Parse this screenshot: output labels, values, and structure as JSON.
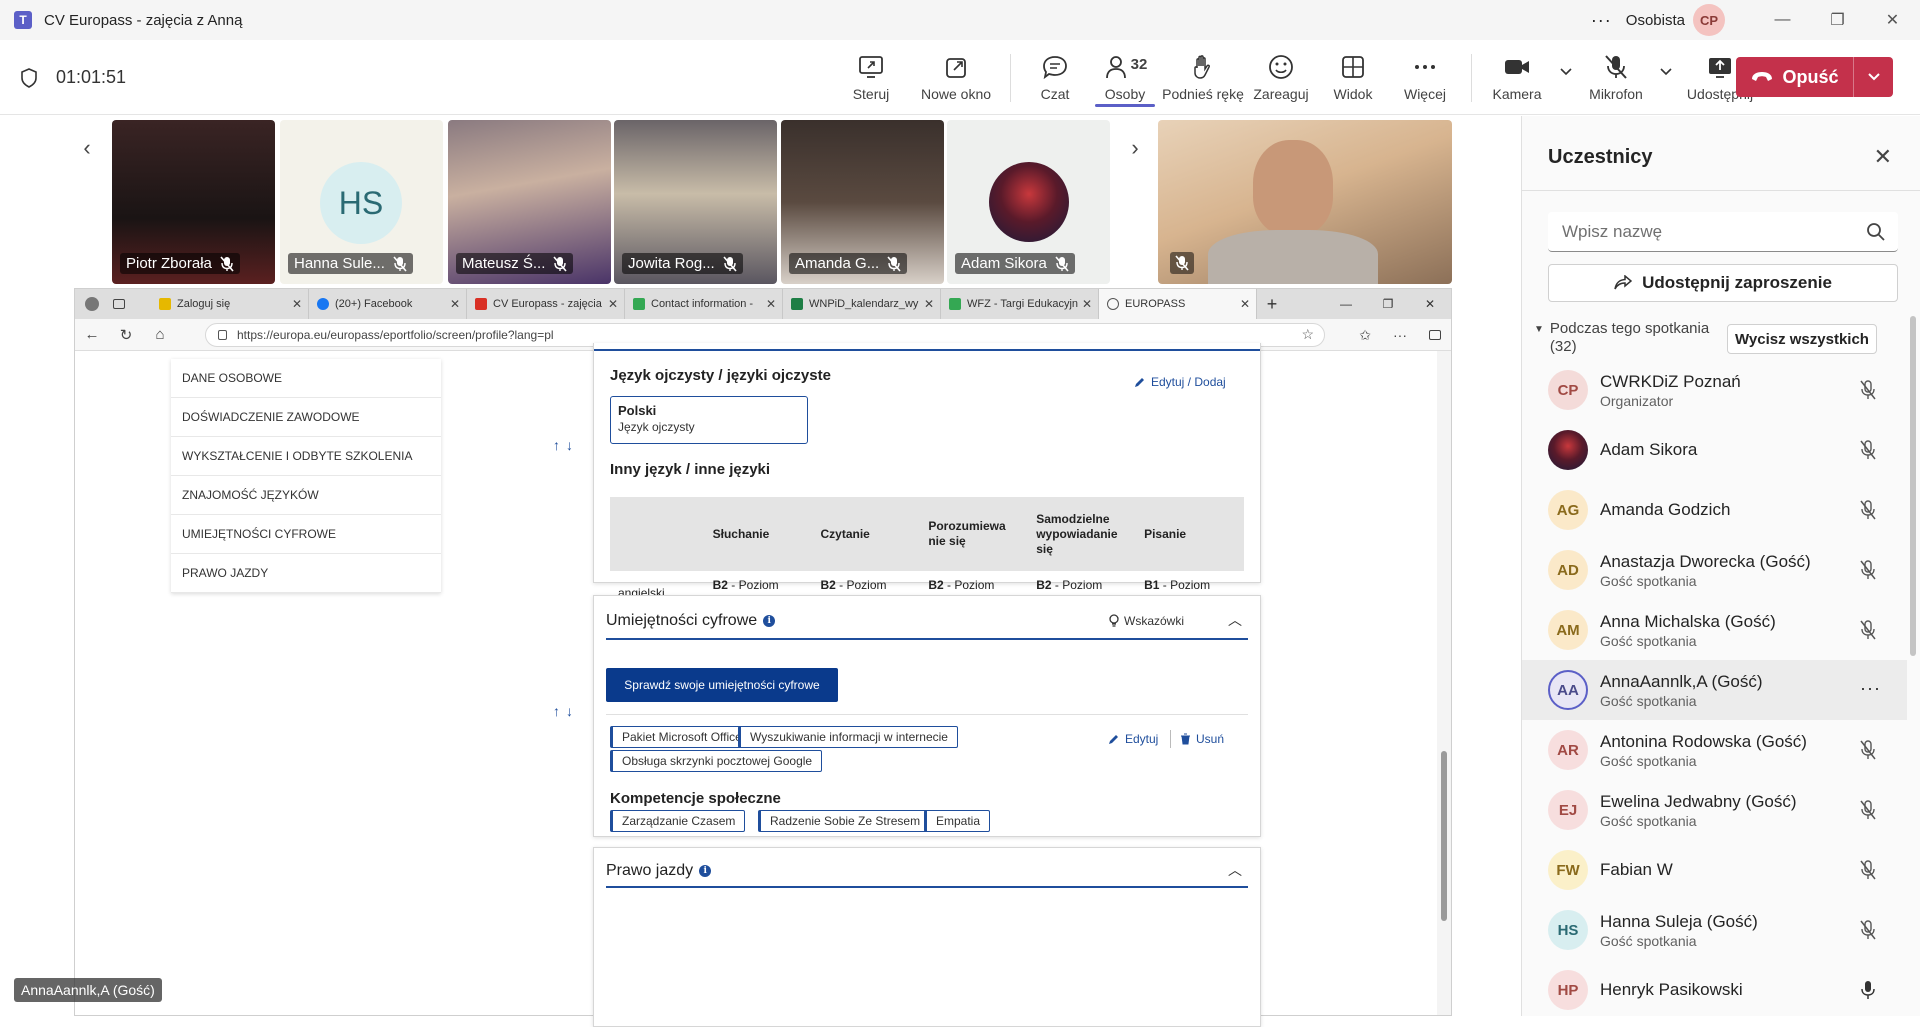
{
  "window": {
    "title": "CV Europass - zajęcia z Anną",
    "profile_label": "Osobista",
    "profile_initials": "CP"
  },
  "meeting": {
    "timer": "01:01:51",
    "people_count": "32",
    "tools": [
      {
        "label": "Steruj",
        "icon": "present-icon"
      },
      {
        "label": "Nowe okno",
        "icon": "pop-out-icon"
      },
      {
        "label": "Czat",
        "icon": "chat-icon"
      },
      {
        "label": "Osoby",
        "icon": "people-icon"
      },
      {
        "label": "Podnieś rękę",
        "icon": "raise-hand-icon"
      },
      {
        "label": "Zareaguj",
        "icon": "react-icon"
      },
      {
        "label": "Widok",
        "icon": "view-icon"
      },
      {
        "label": "Więcej",
        "icon": "more-icon"
      },
      {
        "label": "Kamera",
        "icon": "camera-icon"
      },
      {
        "label": "Mikrofon",
        "icon": "mic-off-icon"
      },
      {
        "label": "Udostępnij",
        "icon": "share-icon"
      }
    ],
    "leave_label": "Opuść"
  },
  "gallery": [
    {
      "name": "Piotr Zborała",
      "bg": "#2a1a1a"
    },
    {
      "name": "Hanna Sule...",
      "bg": "#f3f2ea",
      "initials": "HS"
    },
    {
      "name": "Mateusz Ś...",
      "bg": "#4a3a52"
    },
    {
      "name": "Jowita Rog...",
      "bg": "#8c8890"
    },
    {
      "name": "Amanda G...",
      "bg": "#2e2624"
    },
    {
      "name": "Adam Sikora",
      "bg": "#eef0ee"
    }
  ],
  "self_label": "AnnaAannlk,A (Gość)",
  "browser": {
    "tabs": [
      {
        "label": "Zaloguj się",
        "color": "#e6b800"
      },
      {
        "label": "(20+) Facebook",
        "color": "#1877f2"
      },
      {
        "label": "CV Europass - zajęcia",
        "color": "#d93025"
      },
      {
        "label": "Contact information -",
        "color": "#34a853"
      },
      {
        "label": "WNPiD_kalendarz_wy",
        "color": "#1e7e45"
      },
      {
        "label": "WFZ - Targi Edukacyjn",
        "color": "#34a853"
      },
      {
        "label": "EUROPASS",
        "color": "#555555"
      }
    ],
    "url": "https://europa.eu/europass/eportfolio/screen/profile?lang=pl"
  },
  "leftnav": [
    "DANE OSOBOWE",
    "DOŚWIADCZENIE ZAWODOWE",
    "WYKSZTAŁCENIE I ODBYTE SZKOLENIA",
    "ZNAJOMOŚĆ JĘZYKÓW",
    "UMIEJĘTNOŚCI CYFROWE",
    "PRAWO JAZDY"
  ],
  "languages": {
    "native_heading": "Język ojczysty / języki ojczyste",
    "edit_add": "Edytuj / Dodaj",
    "native_name": "Polski",
    "native_sub": "Język ojczysty",
    "other_heading": "Inny język / inne języki",
    "columns": [
      "Słuchanie",
      "Czytanie",
      "Porozumiewa nie się",
      "Samodzielne wypowiadanie się",
      "Pisanie"
    ],
    "rows": [
      {
        "lang": "angielski",
        "cells": [
          {
            "level": "B2",
            "desc": "Poziom samodzielności"
          },
          {
            "level": "B2",
            "desc": "Poziom samodzielności"
          },
          {
            "level": "B2",
            "desc": "Poziom samodzielności"
          },
          {
            "level": "B2",
            "desc": "Poziom samodzielności"
          },
          {
            "level": "B1",
            "desc": "Poziom samodzielności"
          }
        ]
      }
    ]
  },
  "digital": {
    "title": "Umiejętności cyfrowe",
    "hints": "Wskazówki",
    "check_button": "Sprawdź swoje umiejętności cyfrowe",
    "edit": "Edytuj",
    "delete": "Usuń",
    "skills": [
      "Pakiet Microsoft Office",
      "Wyszukiwanie informacji w internecie",
      "Obsługa skrzynki pocztowej Google"
    ],
    "social_heading": "Kompetencje społeczne",
    "social": [
      "Zarządzanie Czasem",
      "Radzenie Sobie Ze Stresem",
      "Empatia"
    ]
  },
  "license": {
    "title": "Prawo jazdy"
  },
  "panel": {
    "title": "Uczestnicy",
    "search_placeholder": "Wpisz nazwę",
    "invite": "Udostępnij zaproszenie",
    "during": "Podczas tego spotkania (32)",
    "mute_all": "Wycisz wszystkich",
    "participants": [
      {
        "initials": "CP",
        "name": "CWRKDiZ Poznań",
        "role": "Organizator",
        "bg": "#f4dbd9",
        "fg": "#a14a44"
      },
      {
        "initials": "",
        "name": "Adam Sikora",
        "role": "",
        "bg": "#3a2a3a",
        "fg": "#ffffff"
      },
      {
        "initials": "AG",
        "name": "Amanda Godzich",
        "role": "",
        "bg": "#fbe9c9",
        "fg": "#8a6a1c"
      },
      {
        "initials": "AD",
        "name": "Anastazja Dworecka (Gość)",
        "role": "Gość spotkania",
        "bg": "#fbe9c9",
        "fg": "#8a6a1c"
      },
      {
        "initials": "AM",
        "name": "Anna Michalska (Gość)",
        "role": "Gość spotkania",
        "bg": "#fbe9c9",
        "fg": "#8a6a1c"
      },
      {
        "initials": "AA",
        "name": "AnnaAannlk,A (Gość)",
        "role": "Gość spotkania",
        "bg": "#e8e6f5",
        "fg": "#4a4a8a"
      },
      {
        "initials": "AR",
        "name": "Antonina Rodowska (Gość)",
        "role": "Gość spotkania",
        "bg": "#f7dede",
        "fg": "#a14a44"
      },
      {
        "initials": "EJ",
        "name": "Ewelina Jedwabny (Gość)",
        "role": "Gość spotkania",
        "bg": "#f7dede",
        "fg": "#a14a44"
      },
      {
        "initials": "FW",
        "name": "Fabian W",
        "role": "",
        "bg": "#fbf0c9",
        "fg": "#8a6a1c"
      },
      {
        "initials": "HS",
        "name": "Hanna Suleja (Gość)",
        "role": "Gość spotkania",
        "bg": "#d8eef0",
        "fg": "#2a6a73"
      },
      {
        "initials": "HP",
        "name": "Henryk Pasikowski",
        "role": "",
        "bg": "#f7dede",
        "fg": "#a14a44"
      }
    ]
  }
}
